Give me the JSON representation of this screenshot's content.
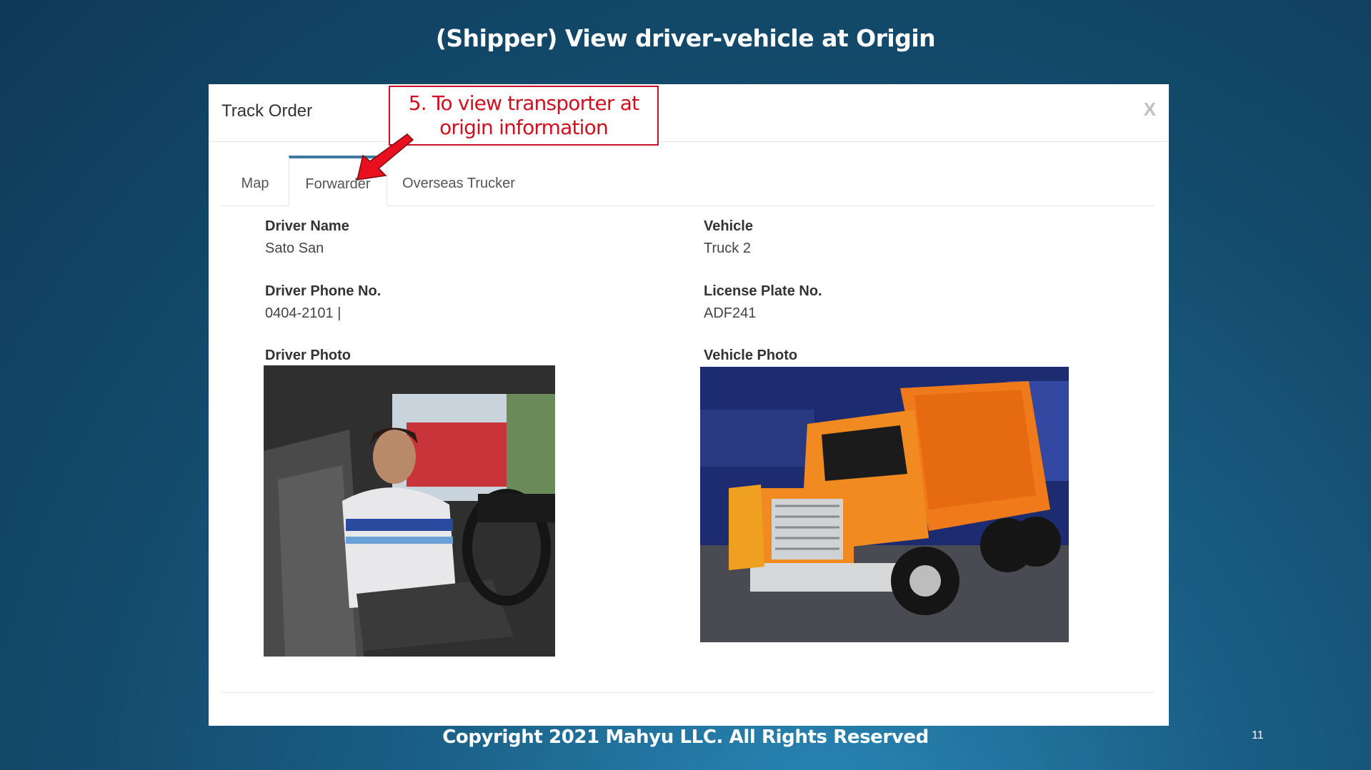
{
  "slide": {
    "title": "(Shipper) View driver-vehicle at Origin",
    "footer": "Copyright 2021 Mahyu LLC. All Rights Reserved",
    "page_number": "11"
  },
  "modal": {
    "title": "Track Order",
    "close_label": "X",
    "tabs": [
      {
        "label": "Map",
        "active": false
      },
      {
        "label": "Forwarder",
        "active": true
      },
      {
        "label": "Overseas Trucker",
        "active": false
      }
    ]
  },
  "annotation": {
    "text_line1": "5. To view transporter at",
    "text_line2": "origin information",
    "arrow_color": "#e8101e"
  },
  "details": {
    "driver_name_label": "Driver Name",
    "driver_name": "Sato San",
    "vehicle_label": "Vehicle",
    "vehicle": "Truck 2",
    "driver_phone_label": "Driver Phone No.",
    "driver_phone": "0404-2101 |",
    "license_plate_label": "License Plate No.",
    "license_plate": "ADF241",
    "driver_photo_label": "Driver Photo",
    "vehicle_photo_label": "Vehicle Photo"
  },
  "colors": {
    "active_tab_accent": "#3c7aa0",
    "callout_border": "#c8102e",
    "callout_text": "#d0101f",
    "background": "#134a6b"
  }
}
